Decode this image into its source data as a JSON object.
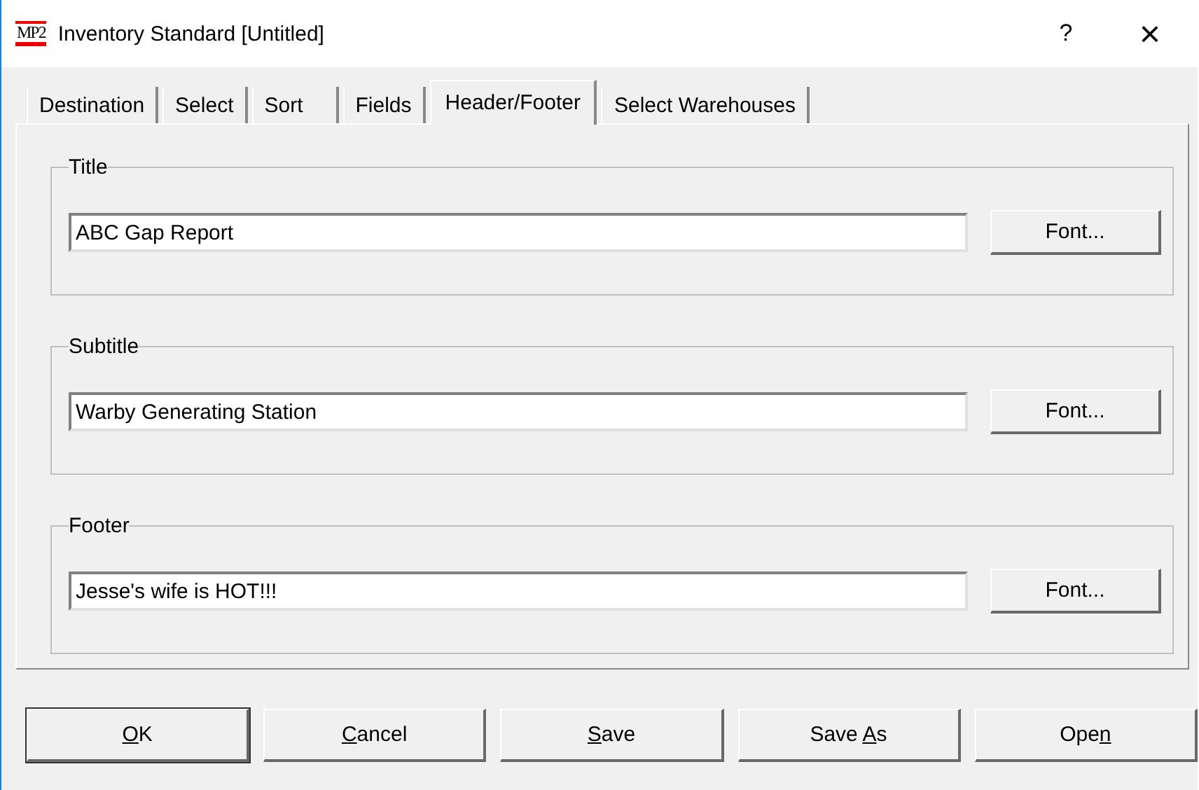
{
  "window": {
    "icon_text": "MP2",
    "title": "Inventory Standard [Untitled]",
    "help": "?",
    "close": "×"
  },
  "tabs": [
    {
      "label": "Destination",
      "selected": false
    },
    {
      "label": "Select",
      "selected": false
    },
    {
      "label": "Sort",
      "selected": false
    },
    {
      "label": "Fields",
      "selected": false
    },
    {
      "label": "Header/Footer",
      "selected": true
    },
    {
      "label": "Select Warehouses",
      "selected": false
    }
  ],
  "groups": [
    {
      "legend": "Title",
      "value": "ABC Gap Report",
      "button": "Font..."
    },
    {
      "legend": "Subtitle",
      "value": "Warby Generating Station",
      "button": "Font..."
    },
    {
      "legend": "Footer",
      "value": "Jesse's wife is HOT!!!",
      "button": "Font..."
    }
  ],
  "buttons": [
    {
      "key": "O",
      "after": "K",
      "default": true
    },
    {
      "key": "C",
      "after": "ancel",
      "default": false
    },
    {
      "key": "S",
      "after": "ave",
      "default": false
    },
    {
      "before": "Save ",
      "key": "A",
      "after": "s",
      "default": false
    },
    {
      "before": "Ope",
      "key": "n",
      "default": false
    }
  ]
}
